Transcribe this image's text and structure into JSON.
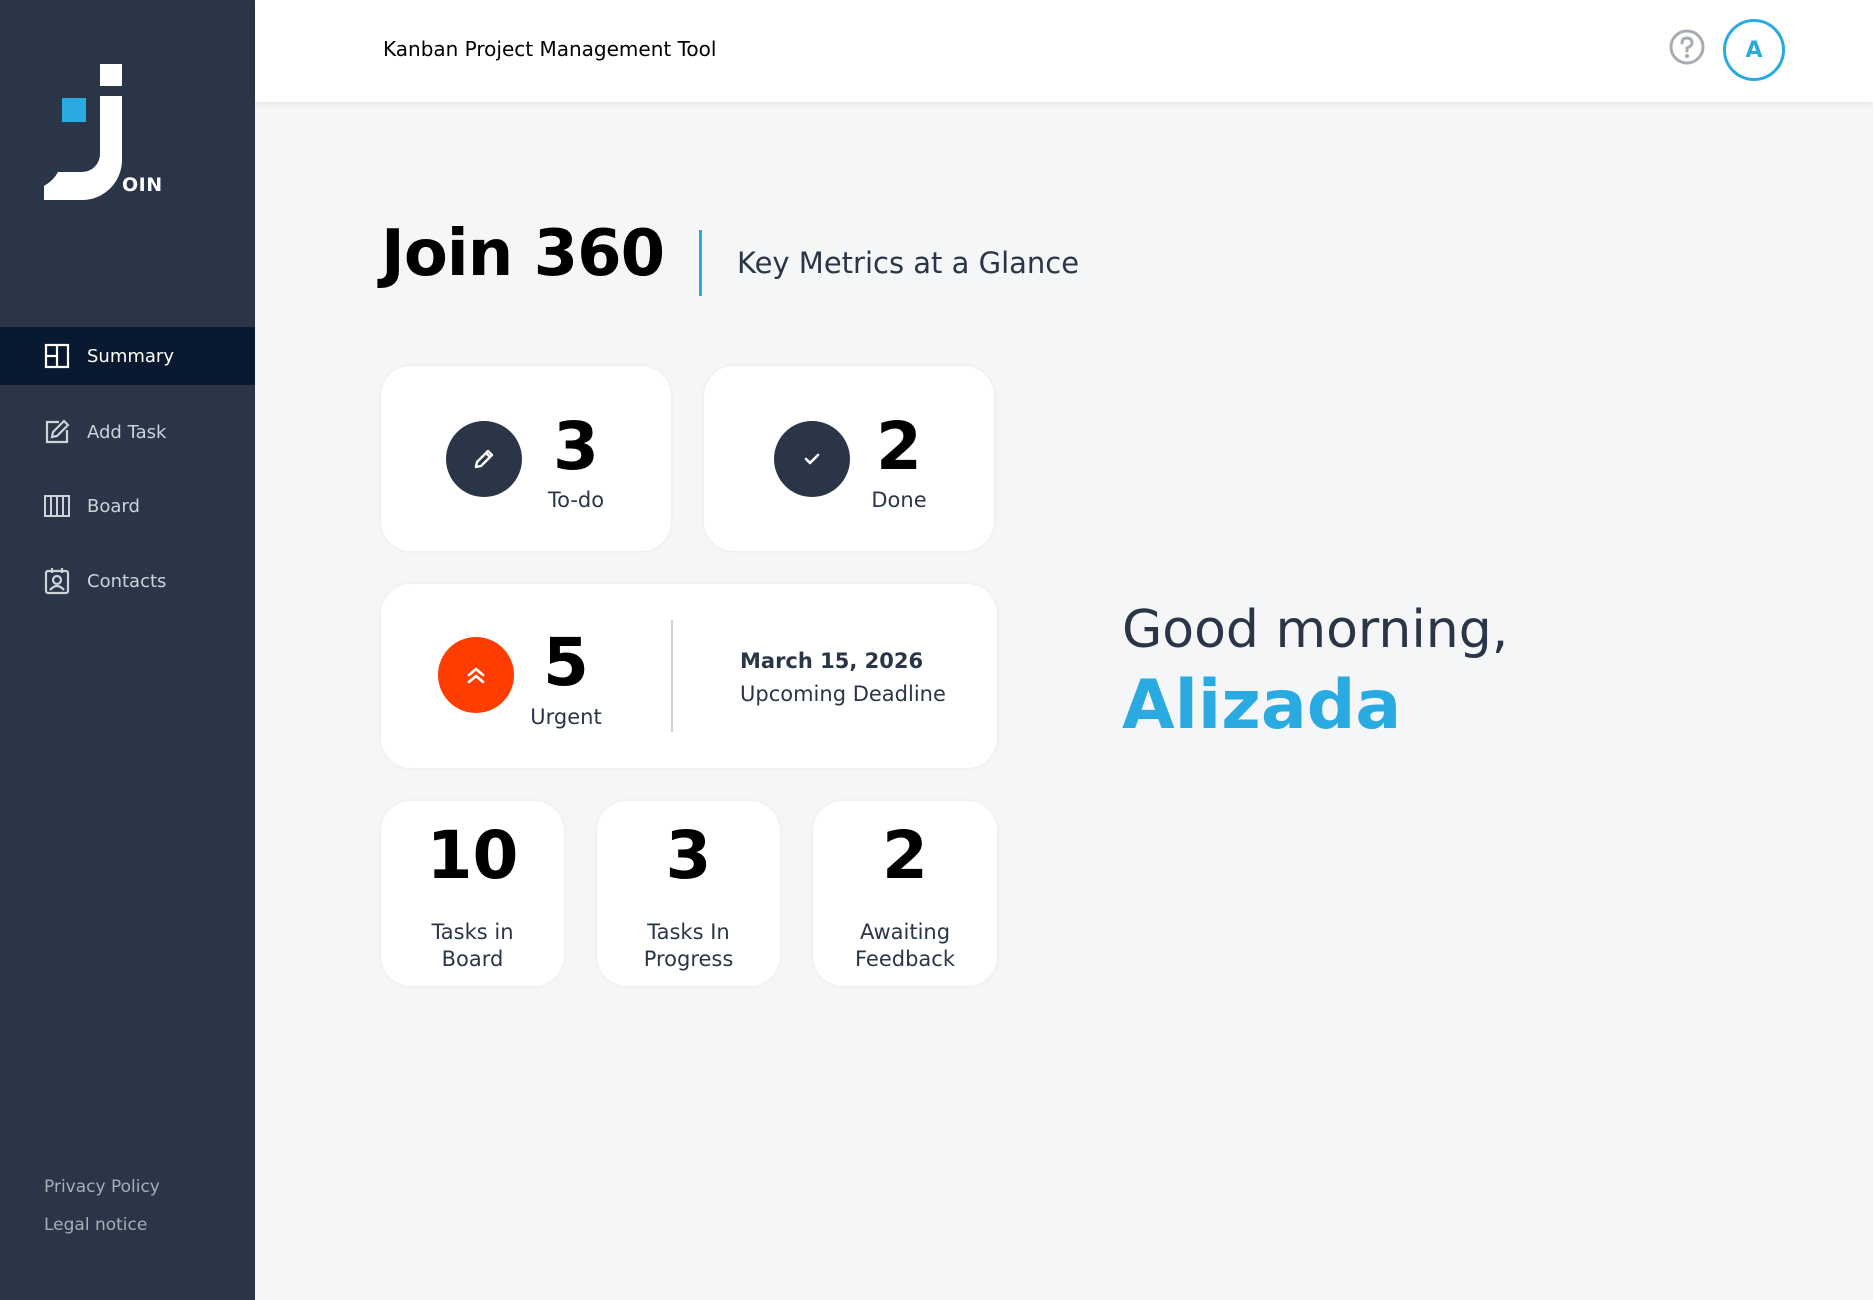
{
  "app": {
    "logo_text": "OIN",
    "header_title": "Kanban Project Management Tool",
    "user_initial": "A"
  },
  "sidebar": {
    "items": [
      {
        "label": "Summary",
        "icon": "summary-icon",
        "active": true
      },
      {
        "label": "Add Task",
        "icon": "add-task-icon",
        "active": false
      },
      {
        "label": "Board",
        "icon": "board-icon",
        "active": false
      },
      {
        "label": "Contacts",
        "icon": "contacts-icon",
        "active": false
      }
    ],
    "footer": {
      "privacy": "Privacy Policy",
      "legal": "Legal notice"
    }
  },
  "page": {
    "title": "Join 360",
    "subtitle": "Key Metrics at a Glance"
  },
  "metrics": {
    "todo": {
      "count": "3",
      "label": "To-do",
      "icon": "pencil-icon"
    },
    "done": {
      "count": "2",
      "label": "Done",
      "icon": "check-icon"
    },
    "urgent": {
      "count": "5",
      "label": "Urgent",
      "icon": "double-chevron-up-icon",
      "deadline_date": "March 15, 2026",
      "deadline_label": "Upcoming Deadline"
    },
    "board": {
      "count": "10",
      "label_line1": "Tasks in",
      "label_line2": "Board"
    },
    "progress": {
      "count": "3",
      "label_line1": "Tasks In",
      "label_line2": "Progress"
    },
    "feedback": {
      "count": "2",
      "label_line1": "Awaiting",
      "label_line2": "Feedback"
    }
  },
  "greeting": {
    "text": "Good morning,",
    "name": "Alizada"
  },
  "colors": {
    "sidebar_bg": "#2a3647",
    "sidebar_active": "#091931",
    "accent": "#29abe2",
    "urgent": "#ff3d00",
    "page_bg": "#f5f6f8"
  }
}
